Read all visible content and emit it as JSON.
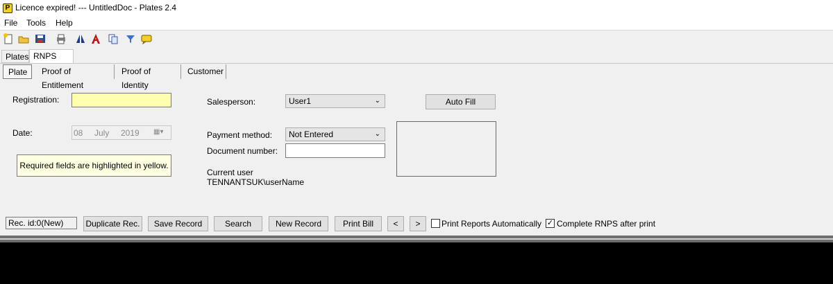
{
  "window": {
    "title": "Licence expired! --- UntitledDoc - Plates 2.4",
    "icon_letter": "P"
  },
  "menu": {
    "items": [
      "File",
      "Tools",
      "Help"
    ]
  },
  "toolbar": {
    "icons": [
      "new-icon",
      "open-folder-icon",
      "save-icon",
      "print-icon",
      "compare-icon",
      "font-icon",
      "copy-icon",
      "filter-icon",
      "message-icon"
    ]
  },
  "tabs": [
    "Plates",
    "RNPS Log"
  ],
  "subtabs": [
    "Plate",
    "Proof of Entitlement",
    "Proof of Identity",
    "Customer"
  ],
  "form": {
    "registration_label": "Registration:",
    "registration_value": "",
    "date_label": "Date:",
    "date_day": "08",
    "date_month": "July",
    "date_year": "2019",
    "note": "Required fields are highlighted in yellow.",
    "salesperson_label": "Salesperson:",
    "salesperson_value": "User1",
    "payment_label": "Payment method:",
    "payment_value": "Not Entered",
    "docnum_label": "Document number:",
    "docnum_value": "",
    "current_user_label": "Current user",
    "current_user_value": "TENNANTSUK\\userName",
    "autofill_label": "Auto Fill"
  },
  "footer": {
    "rec_id": "Rec. id:0(New)",
    "duplicate": "Duplicate Rec.",
    "save": "Save Record",
    "search": "Search",
    "new_record": "New Record",
    "print_bill": "Print Bill",
    "prev": "<",
    "next": ">",
    "print_auto_label": "Print Reports Automatically",
    "print_auto_checked": false,
    "complete_label": "Complete RNPS after print",
    "complete_checked": true
  }
}
